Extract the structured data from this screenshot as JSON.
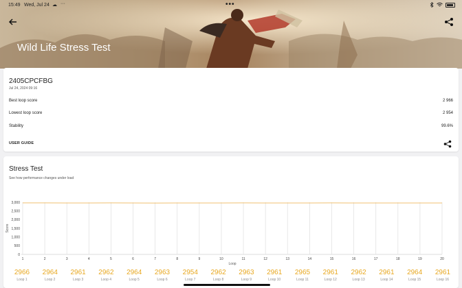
{
  "status": {
    "time": "15:49",
    "date": "Wed, Jul 24",
    "dots": "•••"
  },
  "header": {
    "title": "Wild Life Stress Test"
  },
  "device": {
    "name": "2405CPCFBG",
    "date": "Jul 24, 2024 09:16",
    "rows": [
      {
        "label": "Best loop score",
        "value": "2 966"
      },
      {
        "label": "Lowest loop score",
        "value": "2 954"
      },
      {
        "label": "Stability",
        "value": "99.6%"
      }
    ],
    "user_guide": "USER GUIDE"
  },
  "stress": {
    "title": "Stress Test",
    "subtitle": "See how performance changes under load"
  },
  "chart_data": {
    "type": "line",
    "ylabel": "Score",
    "xlabel": "Loop",
    "ylim": [
      0,
      3000
    ],
    "yticks": [
      "0",
      "500",
      "1,000",
      "1,500",
      "2,000",
      "2,500",
      "3,000"
    ],
    "x": [
      1,
      2,
      3,
      4,
      5,
      6,
      7,
      8,
      9,
      10,
      11,
      12,
      13,
      14,
      15,
      16,
      17,
      18,
      19,
      20
    ],
    "xticks": [
      "1",
      "2",
      "3",
      "4",
      "5",
      "6",
      "7",
      "8",
      "9",
      "10",
      "11",
      "12",
      "13",
      "14",
      "15",
      "16",
      "17",
      "18",
      "19",
      "20"
    ],
    "series": [
      {
        "values": [
          2966,
          2964,
          2961,
          2962,
          2964,
          2963,
          2954,
          2962,
          2963,
          2961,
          2965,
          2961,
          2962,
          2961,
          2964,
          2961,
          2962,
          2963,
          2962,
          2961
        ]
      }
    ],
    "grid": "vertical",
    "color": "#f0c070"
  },
  "loops": [
    {
      "score": "2966",
      "label": "Loop 1"
    },
    {
      "score": "2964",
      "label": "Loop 2"
    },
    {
      "score": "2961",
      "label": "Loop 3"
    },
    {
      "score": "2962",
      "label": "Loop 4"
    },
    {
      "score": "2964",
      "label": "Loop 5"
    },
    {
      "score": "2963",
      "label": "Loop 6"
    },
    {
      "score": "2954",
      "label": "Loop 7"
    },
    {
      "score": "2962",
      "label": "Loop 8"
    },
    {
      "score": "2963",
      "label": "Loop 9"
    },
    {
      "score": "2961",
      "label": "Loop 10"
    },
    {
      "score": "2965",
      "label": "Loop 11"
    },
    {
      "score": "2961",
      "label": "Loop 12"
    },
    {
      "score": "2962",
      "label": "Loop 13"
    },
    {
      "score": "2961",
      "label": "Loop 14"
    },
    {
      "score": "2964",
      "label": "Loop 15"
    },
    {
      "score": "2961",
      "label": "Loop 16"
    }
  ],
  "colors": {
    "accent": "#e8a820",
    "line": "#f0c070"
  }
}
